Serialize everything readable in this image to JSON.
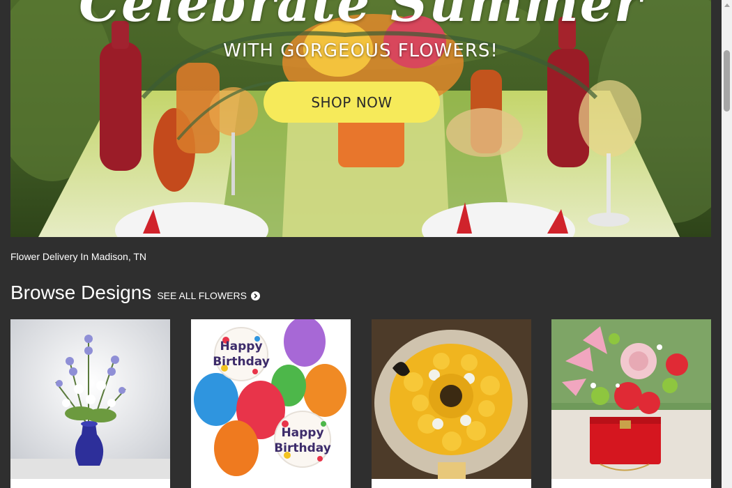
{
  "hero": {
    "script_title": "Celebrate Summer",
    "subtitle": "WITH GORGEOUS FLOWERS!",
    "cta_label": "SHOP NOW"
  },
  "location_text": "Flower Delivery In Madison, TN",
  "browse": {
    "title": "Browse Designs",
    "see_all": "SEE ALL FLOWERS"
  },
  "products": [
    {
      "icon": "blue-vase-bouquet"
    },
    {
      "icon": "happy-birthday-balloons",
      "balloon_text": "Happy Birthday"
    },
    {
      "icon": "yellow-rose-sunflower-bouquet"
    },
    {
      "icon": "pink-red-flowers-red-box"
    }
  ],
  "colors": {
    "background": "#2f2f2f",
    "cta_yellow": "#f6ea5a",
    "text": "#ffffff"
  }
}
